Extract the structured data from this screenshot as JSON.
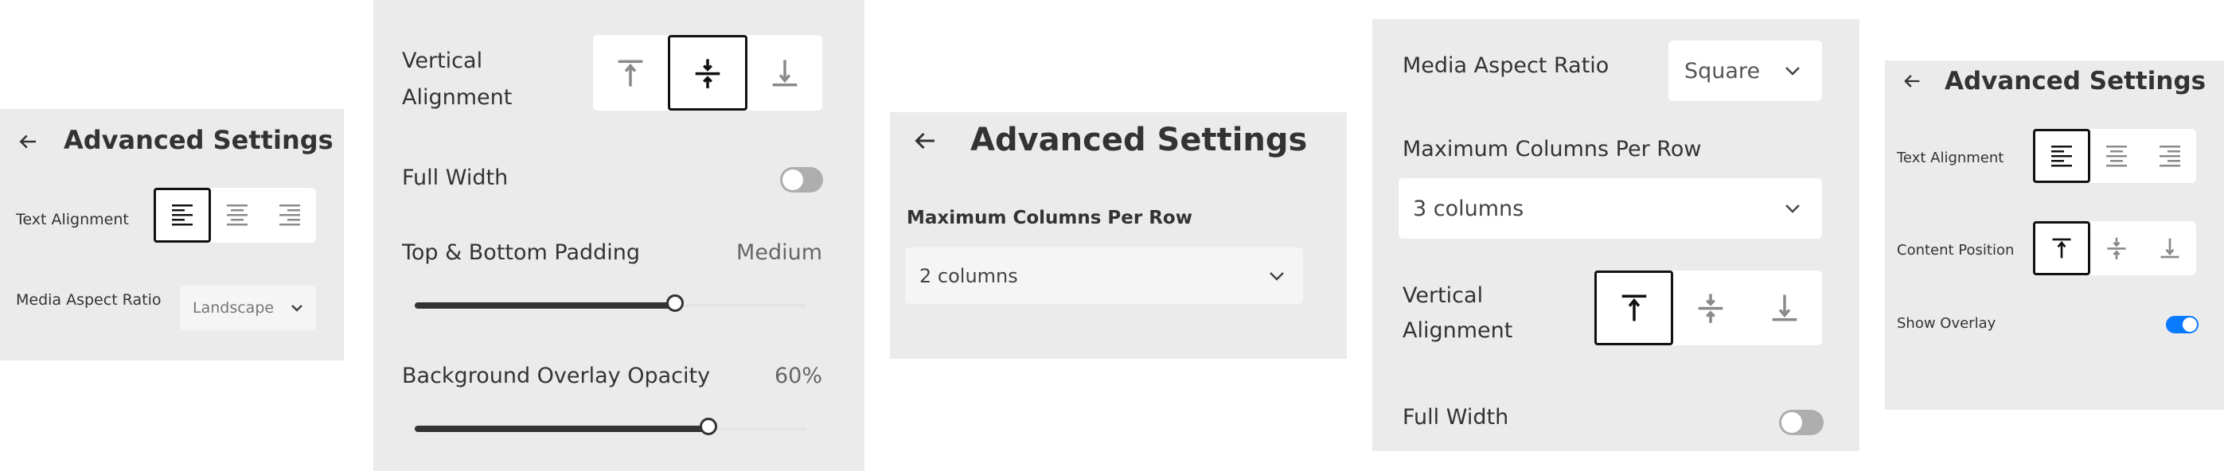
{
  "panels": [
    {
      "id": "panel1",
      "header": {
        "back_icon": "arrow-left-icon",
        "title": "Advanced Settings"
      },
      "text_alignment": {
        "label": "Text Alignment",
        "options": [
          {
            "icon": "align-left-icon",
            "active": true
          },
          {
            "icon": "align-center-icon",
            "active": false
          },
          {
            "icon": "align-right-icon",
            "active": false
          }
        ]
      },
      "media_aspect_ratio": {
        "label": "Media Aspect Ratio",
        "value": "Landscape",
        "icon": "chevron-down-icon"
      }
    },
    {
      "id": "panel2",
      "vertical_alignment": {
        "label_line1": "Vertical",
        "label_line2": "Alignment",
        "options": [
          {
            "icon": "align-top-icon",
            "active": false
          },
          {
            "icon": "align-middle-icon",
            "active": true
          },
          {
            "icon": "align-bottom-icon",
            "active": false
          }
        ]
      },
      "full_width": {
        "label": "Full Width",
        "on": false
      },
      "padding": {
        "label": "Top & Bottom Padding",
        "value_label": "Medium",
        "fraction": 0.665
      },
      "overlay_opacity": {
        "label": "Background Overlay Opacity",
        "value_label": "60%",
        "fraction": 0.75
      }
    },
    {
      "id": "panel3",
      "header": {
        "back_icon": "arrow-left-icon",
        "title": "Advanced Settings"
      },
      "max_columns": {
        "label": "Maximum Columns Per Row",
        "value": "2 columns",
        "icon": "chevron-down-icon"
      }
    },
    {
      "id": "panel4",
      "media_aspect_ratio": {
        "label": "Media Aspect Ratio",
        "value": "Square",
        "icon": "chevron-down-icon"
      },
      "max_columns": {
        "label": "Maximum Columns Per Row",
        "value": "3 columns",
        "icon": "chevron-down-icon"
      },
      "vertical_alignment": {
        "label_line1": "Vertical",
        "label_line2": "Alignment",
        "options": [
          {
            "icon": "align-top-icon",
            "active": true
          },
          {
            "icon": "align-middle-icon",
            "active": false
          },
          {
            "icon": "align-bottom-icon",
            "active": false
          }
        ]
      },
      "full_width": {
        "label": "Full Width",
        "on": false
      }
    },
    {
      "id": "panel5",
      "header": {
        "back_icon": "arrow-left-icon",
        "title": "Advanced Settings"
      },
      "text_alignment": {
        "label": "Text Alignment",
        "options": [
          {
            "icon": "align-left-icon",
            "active": true
          },
          {
            "icon": "align-center-icon",
            "active": false
          },
          {
            "icon": "align-right-icon",
            "active": false
          }
        ]
      },
      "content_position": {
        "label": "Content Position",
        "options": [
          {
            "icon": "align-top-icon",
            "active": true
          },
          {
            "icon": "align-middle-icon",
            "active": false
          },
          {
            "icon": "align-bottom-icon",
            "active": false
          }
        ]
      },
      "show_overlay": {
        "label": "Show Overlay",
        "on": true
      }
    }
  ],
  "colors": {
    "panel_bg": "#EBEBEB",
    "control_bg": "#FFFFFF",
    "select_muted_bg": "#F5F5F5",
    "active_border": "#111111",
    "icon_active": "#111111",
    "icon_inactive": "#8A8A8A",
    "toggle_off": "#AEAEAE",
    "toggle_on": "#0A7AFF",
    "slider_fill": "#333333"
  }
}
